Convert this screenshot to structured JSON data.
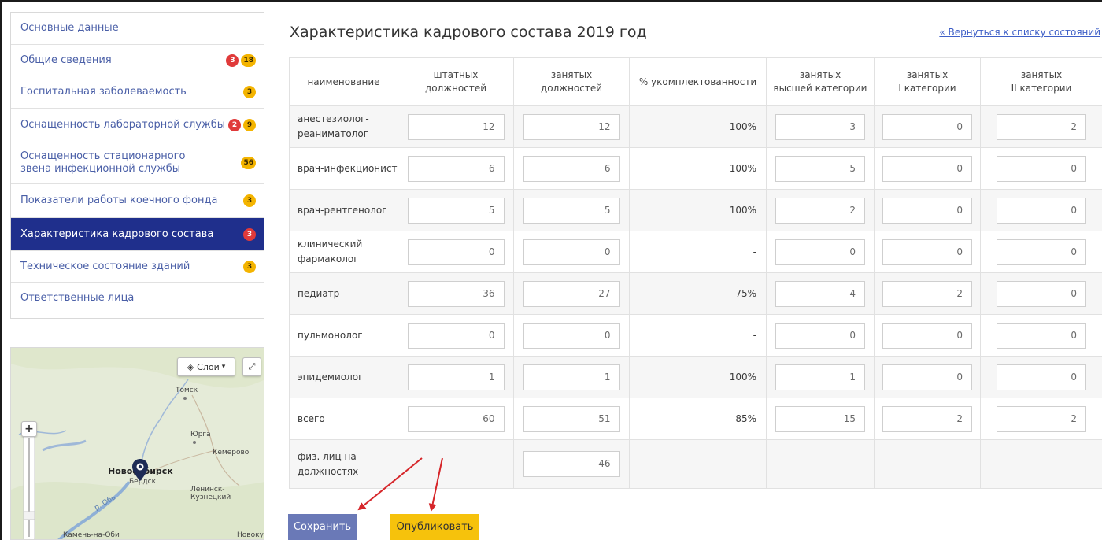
{
  "sidebar": {
    "items": [
      {
        "label": "Основные данные",
        "badges": []
      },
      {
        "label": "Общие сведения",
        "badges": [
          {
            "text": "3",
            "color": "red"
          },
          {
            "text": "18",
            "color": "yellow"
          }
        ]
      },
      {
        "label": "Госпитальная заболеваемость",
        "badges": [
          {
            "text": "3",
            "color": "yellow"
          }
        ]
      },
      {
        "label": "Оснащенность лабораторной службы",
        "badges": [
          {
            "text": "2",
            "color": "red"
          },
          {
            "text": "9",
            "color": "yellow"
          }
        ]
      },
      {
        "label": "Оснащенность стационарного звена инфекционной службы",
        "badges": [
          {
            "text": "56",
            "color": "yellow"
          }
        ]
      },
      {
        "label": "Показатели работы коечного фонда",
        "badges": [
          {
            "text": "3",
            "color": "yellow"
          }
        ]
      },
      {
        "label": "Характеристика кадрового состава",
        "badges": [
          {
            "text": "3",
            "color": "red"
          }
        ],
        "active": true
      },
      {
        "label": "Техническое состояние зданий",
        "badges": [
          {
            "text": "3",
            "color": "yellow"
          }
        ]
      },
      {
        "label": "Ответственные лица",
        "badges": []
      }
    ]
  },
  "map": {
    "layers_label": "Слои",
    "places": {
      "tomsk": "Томск",
      "yurga": "Юрга",
      "kemerovo": "Кемерово",
      "novosibirsk": "Новосибирск",
      "berdsk": "Бердск",
      "leninsk": "Ленинск-Кузнецкий",
      "ob": "р. Обь",
      "kamen": "Камень-на-Оби",
      "novokuz": "Новокуз"
    }
  },
  "header": {
    "title": "Характеристика кадрового состава 2019 год",
    "back_link": "« Вернуться к списку состояний"
  },
  "table": {
    "headers": [
      {
        "l1": "наименование",
        "l2": ""
      },
      {
        "l1": "штатных",
        "l2": "должностей"
      },
      {
        "l1": "занятых",
        "l2": "должностей"
      },
      {
        "l1": "% укомплектованности",
        "l2": ""
      },
      {
        "l1": "занятых",
        "l2": "высшей категории"
      },
      {
        "l1": "занятых",
        "l2": "I категории"
      },
      {
        "l1": "занятых",
        "l2": "II категории"
      }
    ],
    "rows": [
      {
        "name": "анестезиолог-реаниматолог",
        "staff": "12",
        "occupied": "12",
        "pct": "100%",
        "highest": "3",
        "cat1": "0",
        "cat2": "2"
      },
      {
        "name": "врач-инфекционист",
        "staff": "6",
        "occupied": "6",
        "pct": "100%",
        "highest": "5",
        "cat1": "0",
        "cat2": "0"
      },
      {
        "name": "врач-рентгенолог",
        "staff": "5",
        "occupied": "5",
        "pct": "100%",
        "highest": "2",
        "cat1": "0",
        "cat2": "0"
      },
      {
        "name": "клинический фармаколог",
        "staff": "0",
        "occupied": "0",
        "pct": "-",
        "highest": "0",
        "cat1": "0",
        "cat2": "0"
      },
      {
        "name": "педиатр",
        "staff": "36",
        "occupied": "27",
        "pct": "75%",
        "highest": "4",
        "cat1": "2",
        "cat2": "0"
      },
      {
        "name": "пульмонолог",
        "staff": "0",
        "occupied": "0",
        "pct": "-",
        "highest": "0",
        "cat1": "0",
        "cat2": "0"
      },
      {
        "name": "эпидемиолог",
        "staff": "1",
        "occupied": "1",
        "pct": "100%",
        "highest": "1",
        "cat1": "0",
        "cat2": "0"
      },
      {
        "name": "всего",
        "staff": "60",
        "occupied": "51",
        "pct": "85%",
        "highest": "15",
        "cat1": "2",
        "cat2": "2"
      }
    ],
    "phys": {
      "name": "физ. лиц на должностях",
      "occupied": "46"
    }
  },
  "buttons": {
    "save": "Сохранить",
    "publish": "Опубликовать"
  },
  "colors": {
    "active_nav": "#1f2f8c",
    "save_button": "#6a79b7",
    "publish_button": "#f6c20c",
    "badge_red": "#e03a3a",
    "badge_yellow": "#f4b400",
    "annotation_arrow": "#d6262a"
  }
}
